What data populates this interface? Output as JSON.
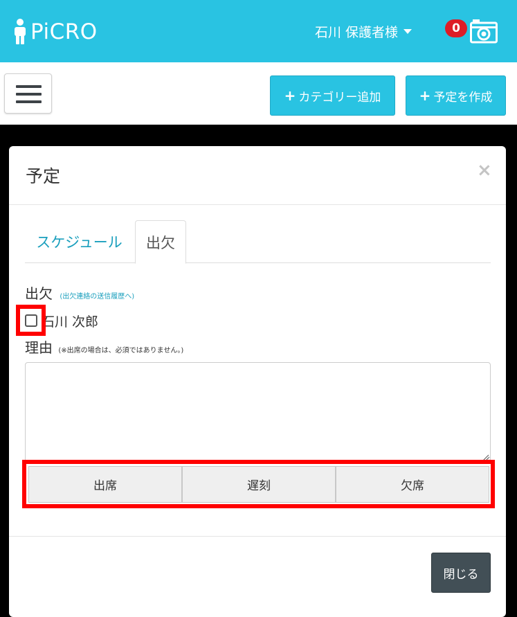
{
  "header": {
    "logo_text": "PiCRO",
    "user_name": "石川 保護者様",
    "notification_count": "0",
    "brand_color": "#29c3e2"
  },
  "toolbar": {
    "add_category_label": "カテゴリー追加",
    "create_event_label": "予定を作成"
  },
  "modal": {
    "title": "予定",
    "close_symbol": "×",
    "tabs": [
      {
        "label": "スケジュール",
        "active": false
      },
      {
        "label": "出欠",
        "active": true
      }
    ],
    "attendance_label": "出欠",
    "attendance_history_link": "(出欠連絡の送信履歴へ)",
    "student_name": "石川 次郎",
    "student_checked": false,
    "reason_label": "理由",
    "reason_note": "(※出席の場合は、必須ではありません。)",
    "reason_value": "",
    "status_buttons": [
      {
        "label": "出席"
      },
      {
        "label": "遅刻"
      },
      {
        "label": "欠席"
      }
    ],
    "footer_close_label": "閉じる"
  }
}
